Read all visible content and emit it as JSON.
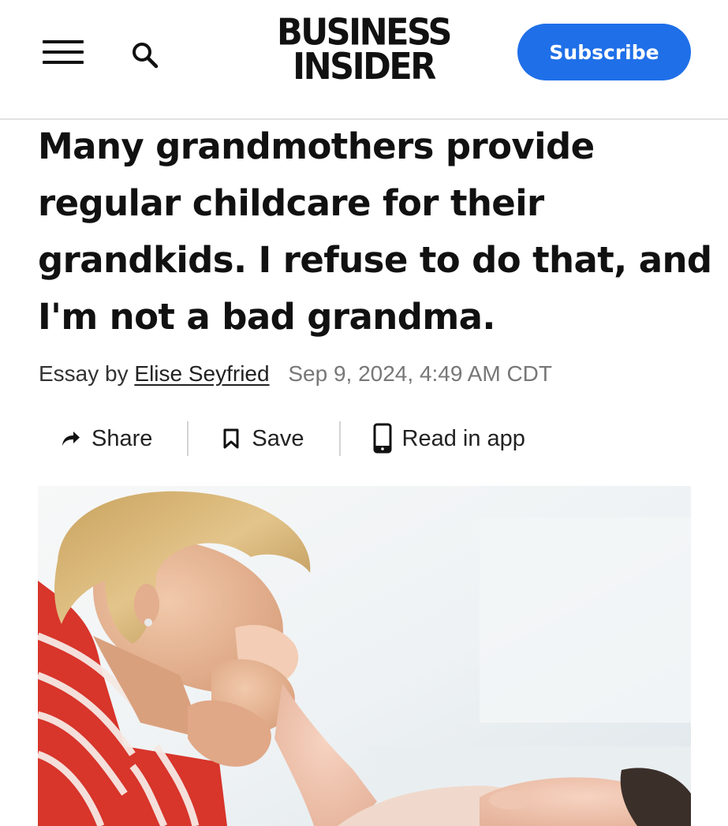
{
  "header": {
    "logo_line1": "BUSINESS",
    "logo_line2": "INSIDER",
    "subscribe_label": "Subscribe",
    "menu_icon": "hamburger-menu-icon",
    "search_icon": "search-icon",
    "brand_color": "#1f6fe8"
  },
  "article": {
    "headline": "Many grandmothers provide regular childcare for their grandkids. I refuse to do that, and I'm not a bad grandma.",
    "byline_prefix": "Essay by",
    "author": "Elise Seyfried",
    "date": "Sep 9, 2024, 4:49 AM CDT"
  },
  "actions": {
    "share_label": "Share",
    "save_label": "Save",
    "read_in_app_label": "Read in app",
    "share_icon": "share-arrow-icon",
    "save_icon": "bookmark-icon",
    "read_in_app_icon": "phone-icon"
  }
}
